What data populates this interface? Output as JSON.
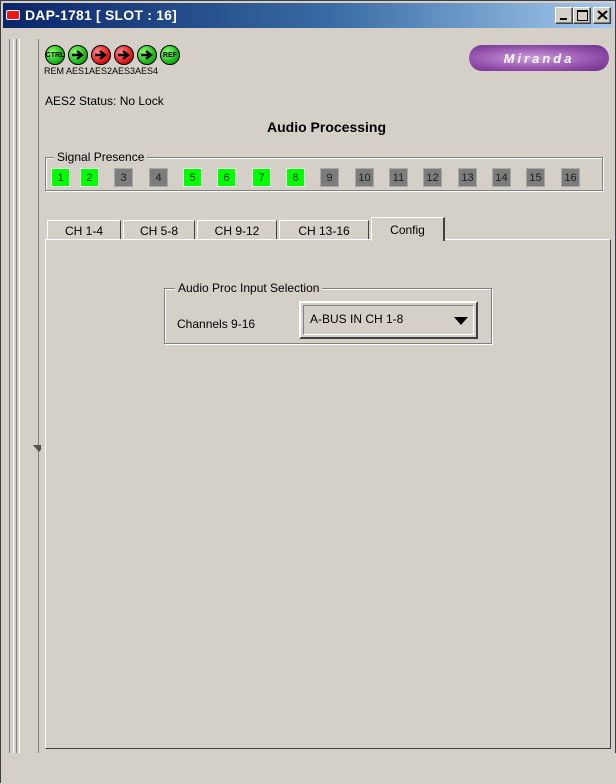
{
  "window": {
    "title": "DAP-1781 [ SLOT : 16]"
  },
  "status_icons": [
    {
      "name": "ctrl-icon",
      "glyph": "CTRL",
      "label": "REM",
      "color": "green"
    },
    {
      "name": "aes1-icon",
      "glyph": "arrow",
      "label": "AES1",
      "color": "green"
    },
    {
      "name": "aes2-icon",
      "glyph": "arrow",
      "label": "AES2",
      "color": "red"
    },
    {
      "name": "aes3-icon",
      "glyph": "arrow",
      "label": "AES3",
      "color": "red"
    },
    {
      "name": "aes4-icon",
      "glyph": "arrow",
      "label": "AES4",
      "color": "green"
    },
    {
      "name": "ref-icon",
      "glyph": "REF",
      "label": "",
      "color": "green"
    }
  ],
  "logo": {
    "text": "Miranda"
  },
  "status_text": "AES2 Status: No Lock",
  "heading": "Audio Processing",
  "signal_presence": {
    "label": "Signal Presence",
    "channels": [
      {
        "label": "1",
        "present": true
      },
      {
        "label": "2",
        "present": true
      },
      {
        "label": "3",
        "present": false
      },
      {
        "label": "4",
        "present": false
      },
      {
        "label": "5",
        "present": true
      },
      {
        "label": "6",
        "present": true
      },
      {
        "label": "7",
        "present": true
      },
      {
        "label": "8",
        "present": true
      },
      {
        "label": "9",
        "present": false
      },
      {
        "label": "10",
        "present": false
      },
      {
        "label": "11",
        "present": false
      },
      {
        "label": "12",
        "present": false
      },
      {
        "label": "13",
        "present": false
      },
      {
        "label": "14",
        "present": false
      },
      {
        "label": "15",
        "present": false
      },
      {
        "label": "16",
        "present": false
      }
    ]
  },
  "tabs": [
    {
      "label": "CH 1-4"
    },
    {
      "label": "CH 5-8"
    },
    {
      "label": "CH 9-12"
    },
    {
      "label": "CH 13-16"
    },
    {
      "label": "Config"
    }
  ],
  "active_tab": "Config",
  "config": {
    "group_label": "Audio Proc Input Selection",
    "field_label": "Channels 9-16",
    "selected_value": "A-BUS IN CH 1-8"
  },
  "colors": {
    "signal_present": "#00ff00",
    "signal_absent": "#7c7c7c",
    "status_ok": "#1eb91e",
    "status_error": "#e21b1b",
    "brand": "#8c4aa6"
  }
}
